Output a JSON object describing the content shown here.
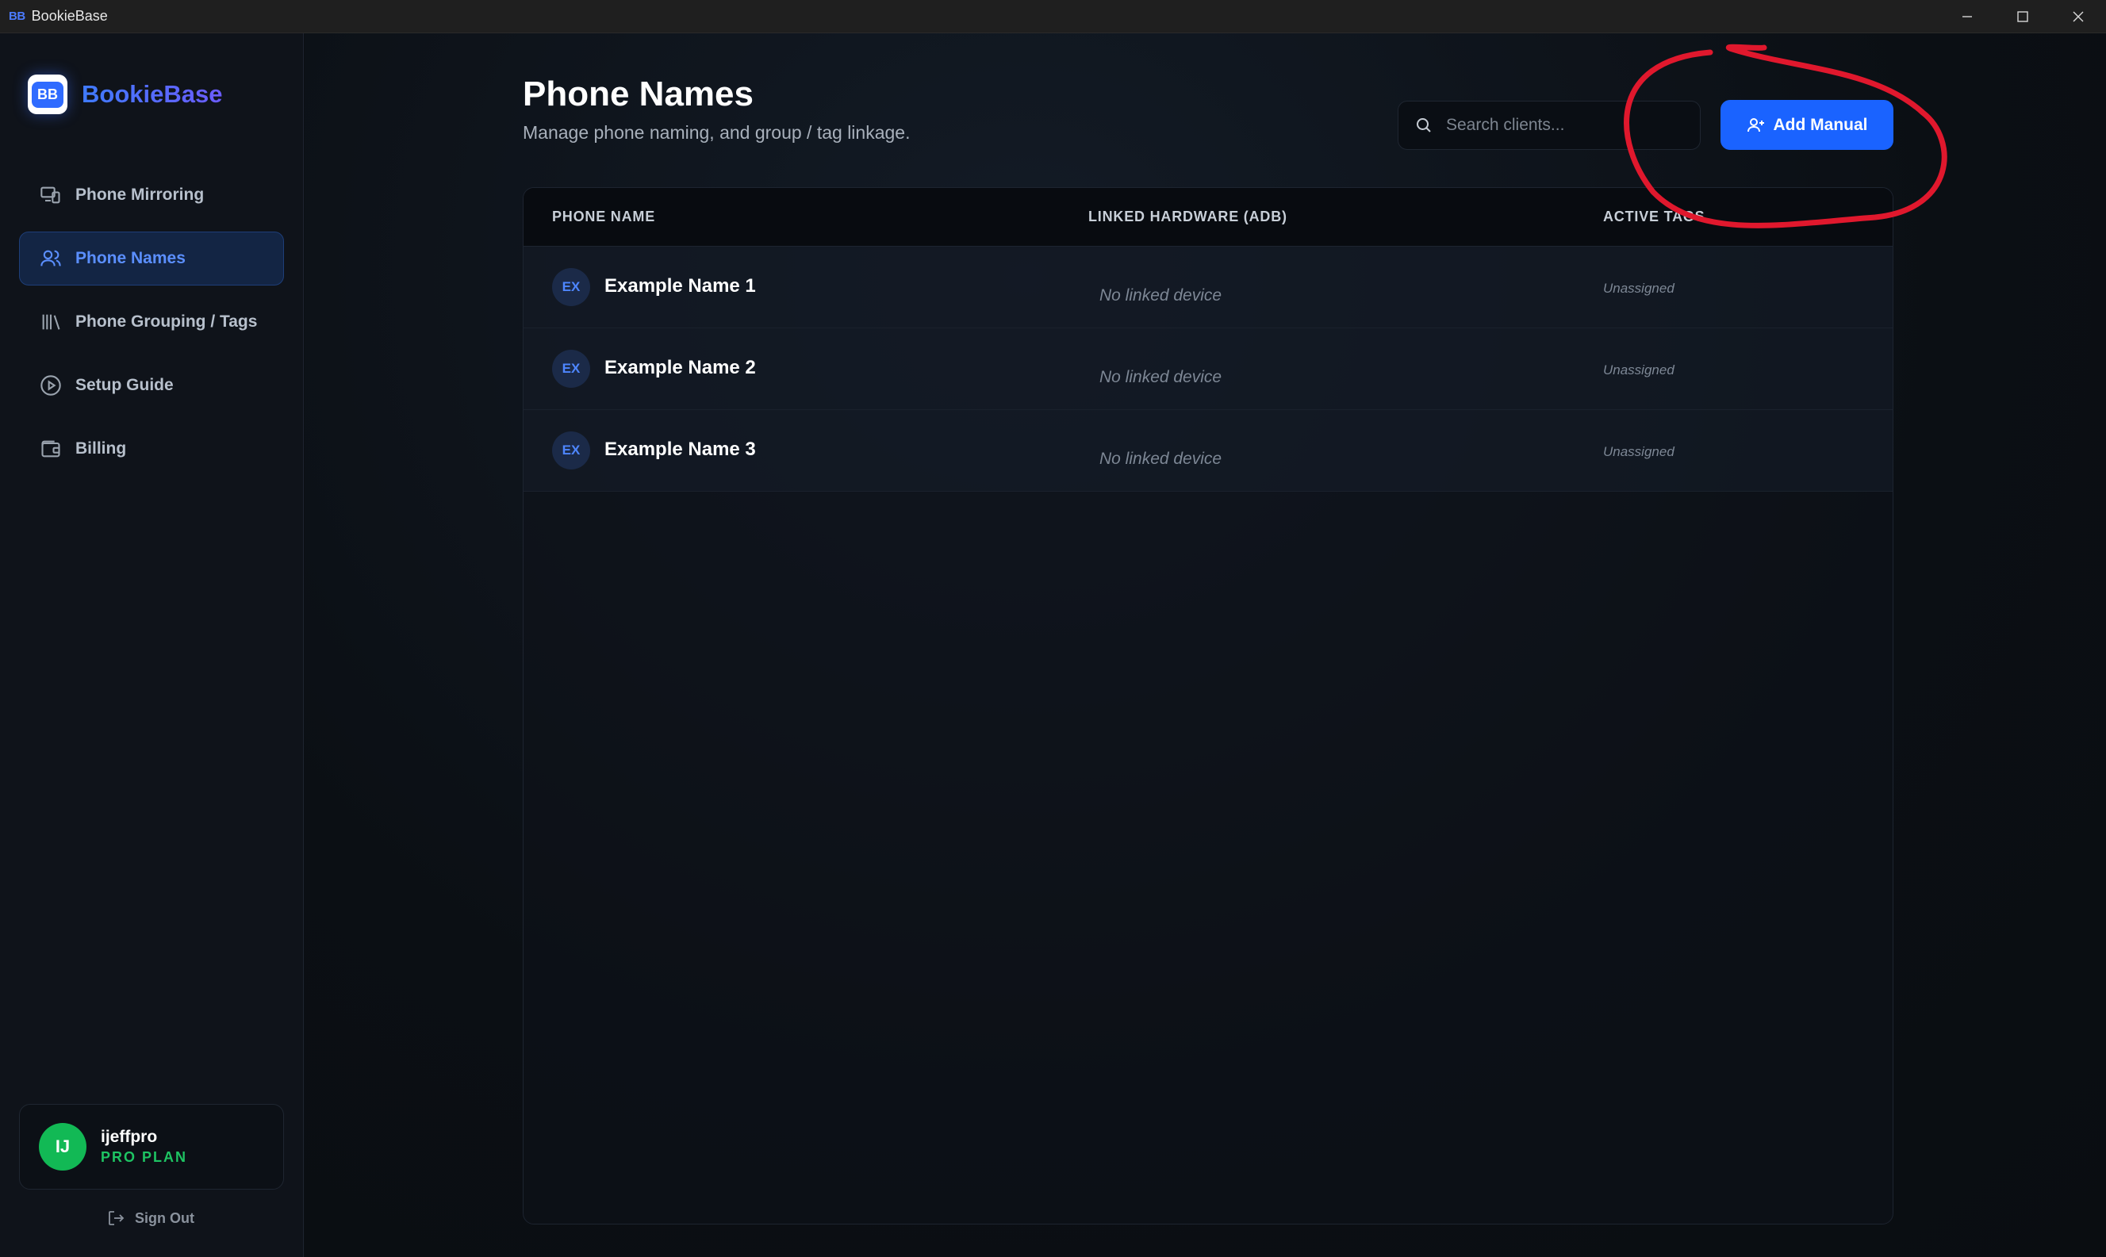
{
  "window": {
    "icon_text": "BB",
    "title": "BookieBase"
  },
  "sidebar": {
    "brand_logo": "BB",
    "brand_name": "BookieBase",
    "items": [
      {
        "label": "Phone Mirroring",
        "icon": "devices-icon",
        "active": false
      },
      {
        "label": "Phone Names",
        "icon": "users-icon",
        "active": true
      },
      {
        "label": "Phone Grouping / Tags",
        "icon": "library-icon",
        "active": false
      },
      {
        "label": "Setup Guide",
        "icon": "play-circle-icon",
        "active": false
      },
      {
        "label": "Billing",
        "icon": "wallet-icon",
        "active": false
      }
    ],
    "user": {
      "initials": "IJ",
      "name": "ijeffpro",
      "plan": "PRO PLAN"
    },
    "signout_label": "Sign Out"
  },
  "main": {
    "title": "Phone Names",
    "subtitle": "Manage phone naming, and group / tag linkage.",
    "search": {
      "placeholder": "Search clients..."
    },
    "add_button_label": "Add Manual",
    "table": {
      "headers": [
        "PHONE NAME",
        "LINKED HARDWARE (ADB)",
        "ACTIVE TAGS"
      ],
      "rows": [
        {
          "badge": "EX",
          "name": "Example Name 1",
          "hardware": "No linked device",
          "tags": "Unassigned"
        },
        {
          "badge": "EX",
          "name": "Example Name 2",
          "hardware": "No linked device",
          "tags": "Unassigned"
        },
        {
          "badge": "EX",
          "name": "Example Name 3",
          "hardware": "No linked device",
          "tags": "Unassigned"
        }
      ]
    }
  },
  "colors": {
    "accent": "#1a63ff",
    "annotation": "#e0182d",
    "plan_green": "#1ec463"
  }
}
